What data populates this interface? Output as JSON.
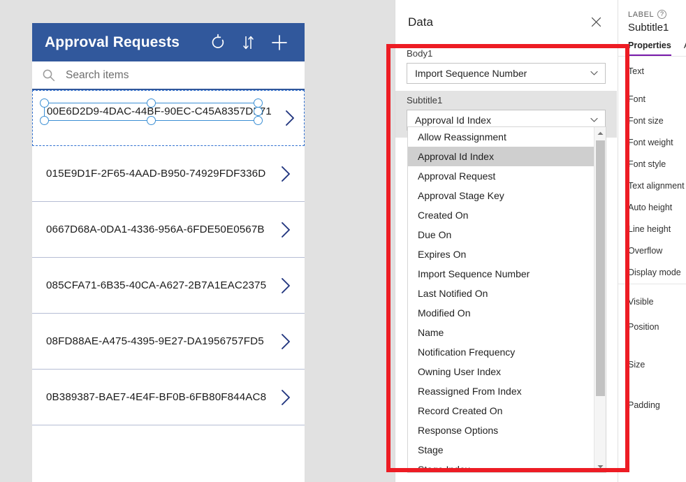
{
  "app": {
    "title": "Approval Requests",
    "header_color": "#31589c",
    "icons": [
      {
        "name": "refresh-icon",
        "label": "Refresh"
      },
      {
        "name": "sort-icon",
        "label": "Sort"
      },
      {
        "name": "add-icon",
        "label": "Add"
      }
    ],
    "search": {
      "placeholder": "Search items"
    },
    "gallery": {
      "items": [
        {
          "text": "00E6D2D9-4DAC-44BF-90EC-C45A8357DF71",
          "selected": true
        },
        {
          "text": "015E9D1F-2F65-4AAD-B950-74929FDF336D",
          "selected": false
        },
        {
          "text": "0667D68A-0DA1-4336-956A-6FDE50E0567B",
          "selected": false
        },
        {
          "text": "085CFA71-6B35-40CA-A627-2B7A1EAC2375",
          "selected": false
        },
        {
          "text": "08FD88AE-A475-4395-9E27-DA1956757FD5",
          "selected": false
        },
        {
          "text": "0B389387-BAE7-4E4F-BF0B-6FB80F844AC8",
          "selected": false
        }
      ]
    }
  },
  "data_panel": {
    "title": "Data",
    "close_label": "✕",
    "fields": [
      {
        "label": "Body1",
        "value": "Import Sequence Number"
      },
      {
        "label": "Subtitle1",
        "value": "Approval Id Index"
      }
    ],
    "dropdown": {
      "selected": "Approval Id Index",
      "options": [
        "Allow Reassignment",
        "Approval Id Index",
        "Approval Request",
        "Approval Stage Key",
        "Created On",
        "Due On",
        "Expires On",
        "Import Sequence Number",
        "Last Notified On",
        "Modified On",
        "Name",
        "Notification Frequency",
        "Owning User Index",
        "Reassigned From Index",
        "Record Created On",
        "Response Options",
        "Stage",
        "Stage Index"
      ]
    }
  },
  "properties_panel": {
    "kind": "LABEL",
    "help_glyph": "?",
    "name": "Subtitle1",
    "tabs": [
      {
        "label": "Properties",
        "selected": true
      },
      {
        "label": "A",
        "selected": false
      }
    ],
    "accent_color": "#7719aa",
    "group1": [
      "Text",
      "Font",
      "Font size",
      "Font weight",
      "Font style",
      "Text alignment",
      "Auto height",
      "Line height",
      "Overflow",
      "Display mode"
    ],
    "group2": [
      "Visible",
      "Position",
      "Size",
      "Padding"
    ]
  },
  "annotation": {
    "color": "#ed1c24",
    "shape": "rectangle"
  }
}
